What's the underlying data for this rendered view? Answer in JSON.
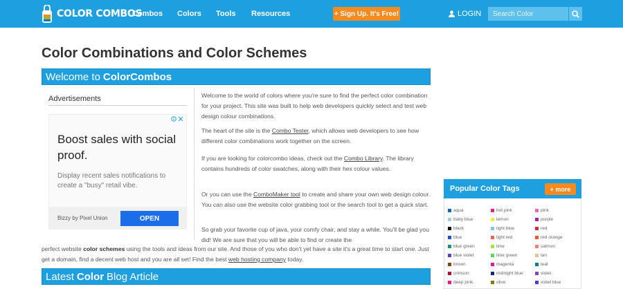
{
  "header": {
    "logo_text": "COLOR COMBOS",
    "nav": [
      "Combos",
      "Colors",
      "Tools",
      "Resources"
    ],
    "signup_label": "+ Sign Up. It's Free!",
    "login_label": "LOGIN",
    "search_placeholder": "Search Color",
    "bar_color": "#1ea0e0",
    "signup_color": "#f58a1f"
  },
  "page_title": "Color Combinations and Color Schemes",
  "welcome": {
    "prefix": "Welcome to",
    "brand": "ColorCombos"
  },
  "ads": {
    "label": "Advertisements",
    "headline": "Boost sales with social proof.",
    "body": "Display recent sales notifications to create a \"busy\" retail vibe.",
    "brand": "Bizzy by Pixel Union",
    "cta": "OPEN"
  },
  "content": {
    "p1": "Welcome to the world of colors where you're sure to find the perfect color combination for your project. This site was built to help web developers quickly select and test web design colour combinations.",
    "p2_pre": "The heart of the site is the ",
    "p2_link": "Combo Tester",
    "p2_post": ", which allows web developers to see how different color combinations work together on the screen.",
    "p3_pre": "If you are looking for colorcombo ideas, check out the ",
    "p3_link": "Combo Library",
    "p3_post": ". The library contains hundreds of color swatches, along with their hex colour values.",
    "p4_pre": "Or you can use the ",
    "p4_link": "ComboMaker tool",
    "p4_post": " to create and share your own web design colour. You can also use the website color grabbing tool or the search tool to get a quick start.",
    "p5a": "So grab your favorite cup of java, your comfy chair, and stay a while. You'll be glad you did! We are sure that you will be able to find or create the",
    "p5b_pre": "perfect website ",
    "p5b_bold": "color schemes",
    "p5b_mid": " using the tools and ideas from our site. And those of you who don't yet have a site it's a great time to start one. Just get a domain, find a decent web host and you are all set! Find the best ",
    "p5b_link": "web hosting company",
    "p5b_post": " today."
  },
  "blog": {
    "prefix": "Latest",
    "bold": "Color",
    "suffix": "Blog Article"
  },
  "sidebar": {
    "title": "Popular Color Tags",
    "more_label": "+ more",
    "tags": [
      {
        "name": "aqua",
        "color": "#1565c0"
      },
      {
        "name": "hot pink",
        "color": "#e91e8c"
      },
      {
        "name": "pink",
        "color": "#f06ab0"
      },
      {
        "name": "baby blue",
        "color": "#9ecbf0"
      },
      {
        "name": "lemon",
        "color": "#f4e842"
      },
      {
        "name": "purple",
        "color": "#9b27b0"
      },
      {
        "name": "black",
        "color": "#111111"
      },
      {
        "name": "light blue",
        "color": "#82c6f5"
      },
      {
        "name": "red",
        "color": "#d32f2f"
      },
      {
        "name": "blue",
        "color": "#1a4fd6"
      },
      {
        "name": "light red",
        "color": "#f06060"
      },
      {
        "name": "red orange",
        "color": "#f05a28"
      },
      {
        "name": "blue green",
        "color": "#0d9488"
      },
      {
        "name": "lime",
        "color": "#a3e635"
      },
      {
        "name": "salmon",
        "color": "#fa8072"
      },
      {
        "name": "blue violet",
        "color": "#5b3fc4"
      },
      {
        "name": "lime green",
        "color": "#5fd35f"
      },
      {
        "name": "tan",
        "color": "#d8c7a0"
      },
      {
        "name": "brown",
        "color": "#8b4513"
      },
      {
        "name": "magenta",
        "color": "#d81b9a"
      },
      {
        "name": "teal",
        "color": "#0e7c7b"
      },
      {
        "name": "crimson",
        "color": "#b0102c"
      },
      {
        "name": "midnight blue",
        "color": "#1a237e"
      },
      {
        "name": "violet",
        "color": "#8e44ad"
      },
      {
        "name": "deep pink",
        "color": "#ff1493"
      },
      {
        "name": "olive",
        "color": "#808000"
      },
      {
        "name": "violet blue",
        "color": "#4b3ccf"
      }
    ]
  }
}
